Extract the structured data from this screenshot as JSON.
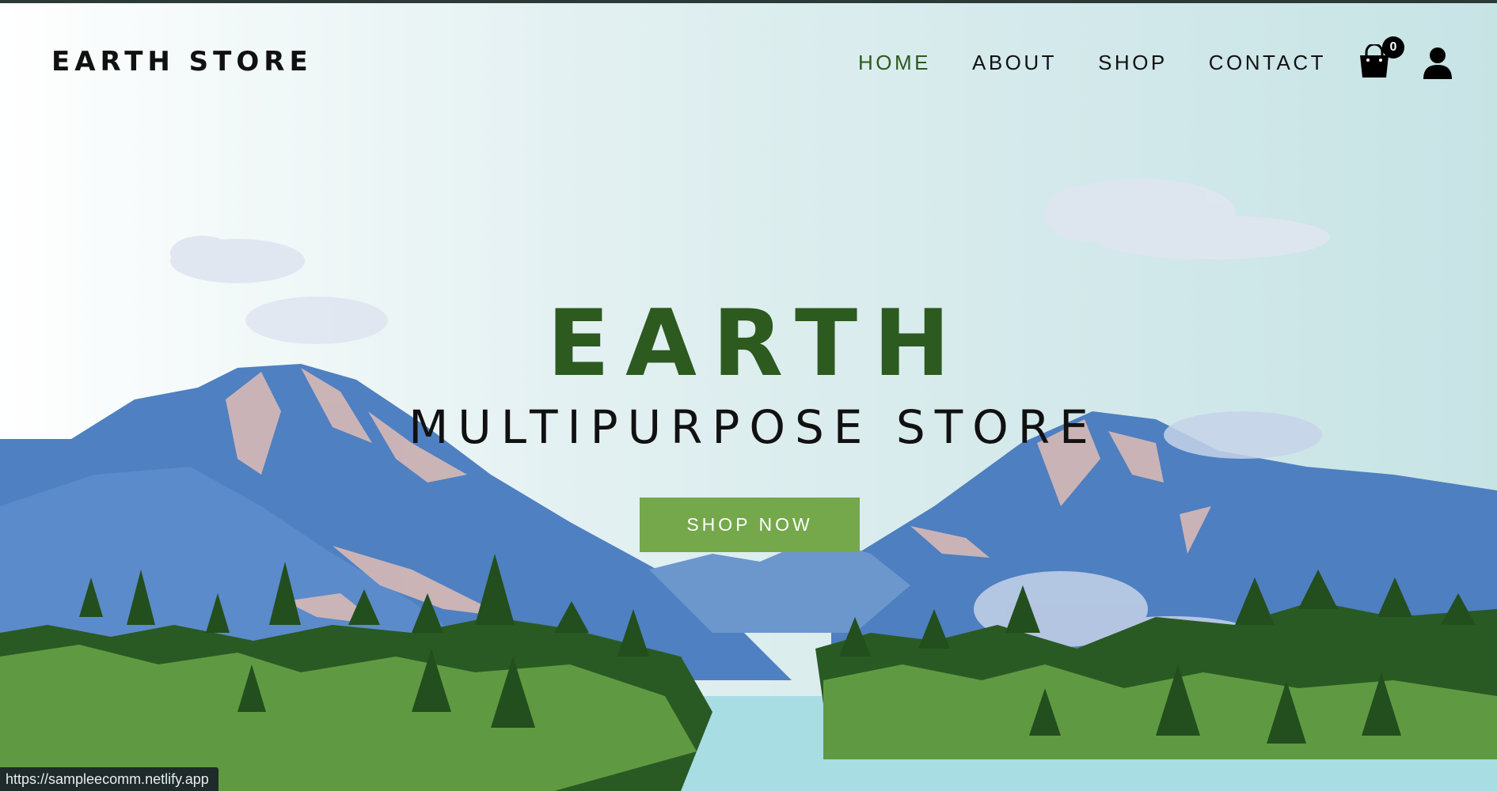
{
  "brand": {
    "logo_text": "EARTH STORE"
  },
  "nav": {
    "items": [
      {
        "label": "HOME",
        "active": true
      },
      {
        "label": "ABOUT",
        "active": false
      },
      {
        "label": "SHOP",
        "active": false
      },
      {
        "label": "CONTACT",
        "active": false
      }
    ]
  },
  "header_icons": {
    "cart_icon": "shopping-bag-icon",
    "cart_count": "0",
    "user_icon": "user-icon"
  },
  "hero": {
    "title": "EARTH",
    "subtitle": "MULTIPURPOSE STORE",
    "cta_label": "SHOP NOW"
  },
  "status_bar": {
    "url": "https://sampleecomm.netlify.app"
  },
  "colors": {
    "brand_green": "#2c5a1f",
    "button_green": "#74a84a",
    "nav_text": "#111111",
    "mountain_blue": "#4f7fc0",
    "lake": "#a9dde4"
  }
}
